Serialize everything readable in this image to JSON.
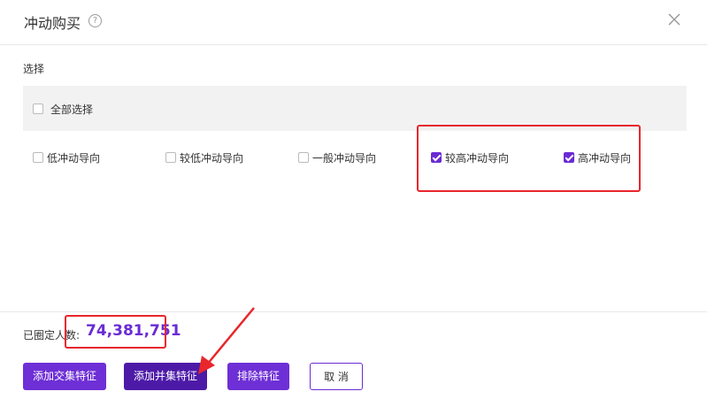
{
  "dialog": {
    "title": "冲动购买",
    "help_icon": "question-circle-icon",
    "close_icon": "close-icon",
    "section_label": "选择",
    "select_all_label": "全部选择",
    "select_all_checked": false,
    "options": [
      {
        "label": "低冲动导向",
        "checked": false
      },
      {
        "label": "较低冲动导向",
        "checked": false
      },
      {
        "label": "一般冲动导向",
        "checked": false
      },
      {
        "label": "较高冲动导向",
        "checked": true
      },
      {
        "label": "高冲动导向",
        "checked": true
      }
    ],
    "count_label": "已圈定人数:",
    "count_value": "74,381,751",
    "buttons": {
      "intersection": "添加交集特征",
      "union": "添加并集特征",
      "exclude": "排除特征",
      "cancel": "取 消"
    }
  },
  "colors": {
    "accent": "#6e2fd6",
    "accent_dark": "#4d1aa8",
    "highlight": "#e8262c",
    "count": "#6a2bd4"
  }
}
